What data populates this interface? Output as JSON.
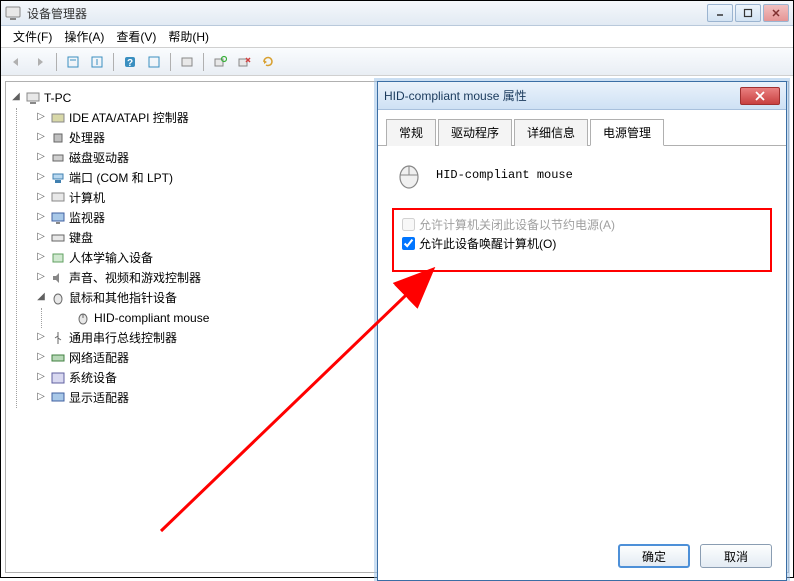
{
  "window": {
    "title": "设备管理器"
  },
  "menu": {
    "file": "文件(F)",
    "action": "操作(A)",
    "view": "查看(V)",
    "help": "帮助(H)"
  },
  "tree": {
    "root": "T-PC",
    "items": [
      "IDE ATA/ATAPI 控制器",
      "处理器",
      "磁盘驱动器",
      "端口 (COM 和 LPT)",
      "计算机",
      "监视器",
      "键盘",
      "人体学输入设备",
      "声音、视频和游戏控制器",
      "鼠标和其他指针设备",
      "通用串行总线控制器",
      "网络适配器",
      "系统设备",
      "显示适配器"
    ],
    "mouse_child": "HID-compliant mouse"
  },
  "dialog": {
    "title": "HID-compliant mouse 属性",
    "tabs": [
      "常规",
      "驱动程序",
      "详细信息",
      "电源管理"
    ],
    "device_name": "HID-compliant mouse",
    "cb1": "允许计算机关闭此设备以节约电源(A)",
    "cb2": "允许此设备唤醒计算机(O)",
    "ok": "确定",
    "cancel": "取消"
  }
}
